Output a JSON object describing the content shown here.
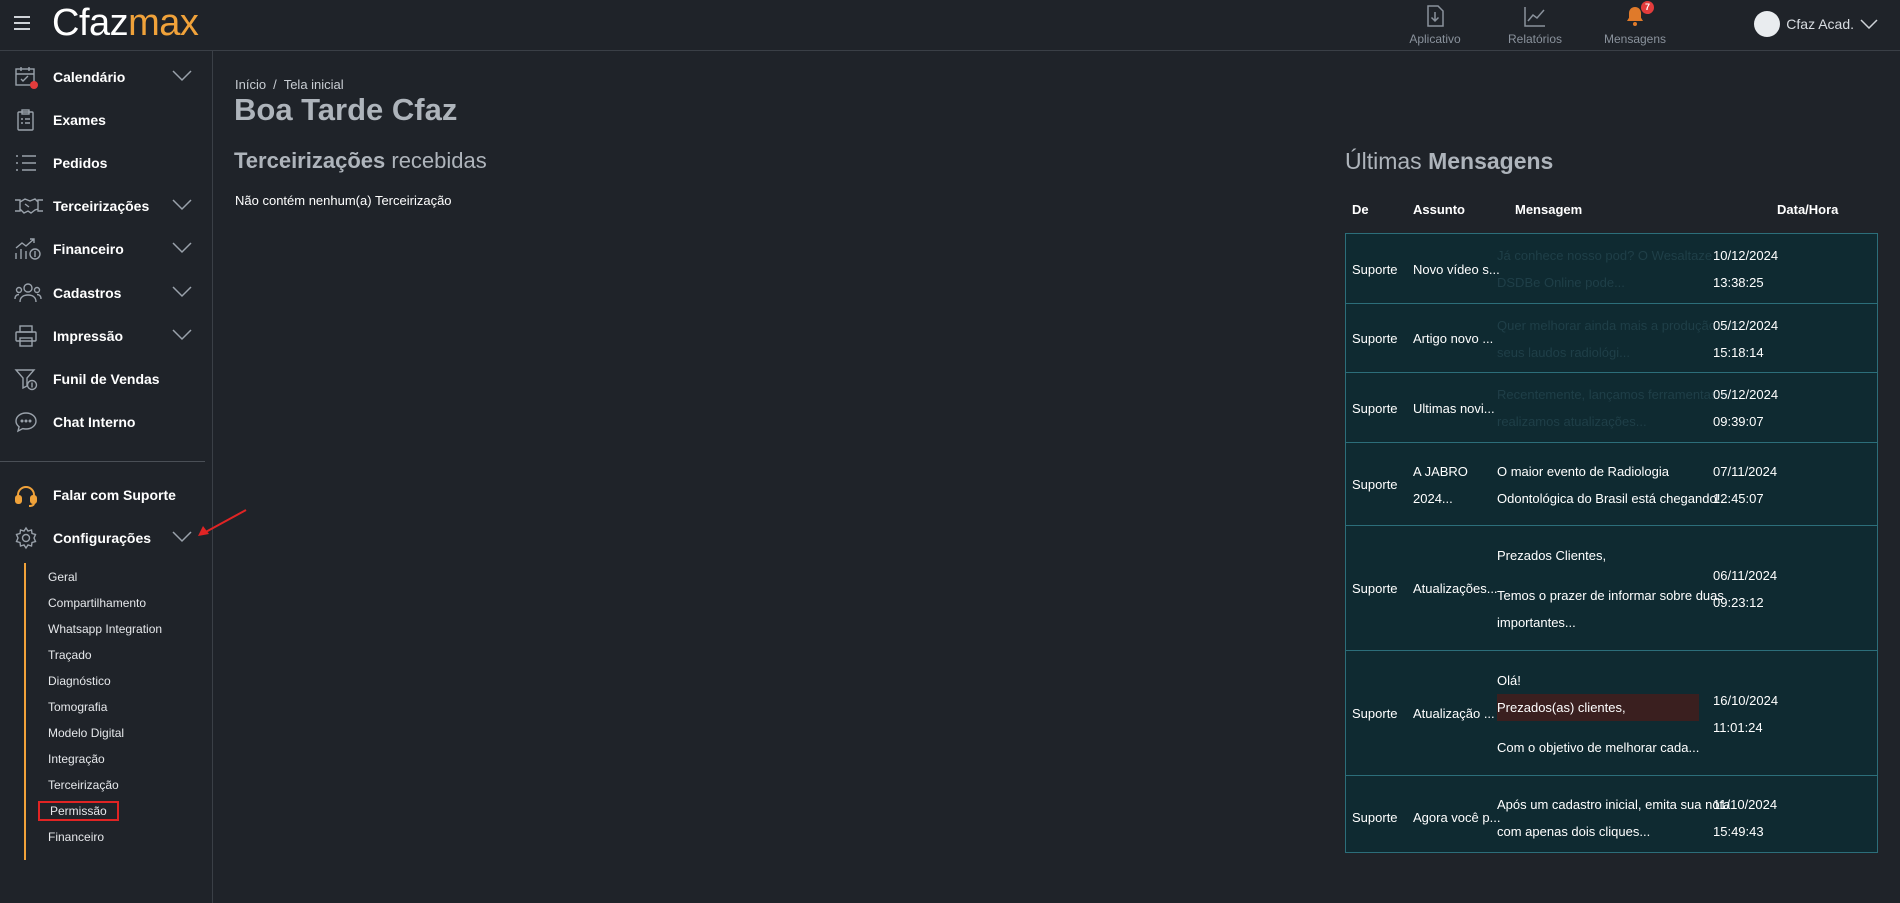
{
  "header": {
    "logo_part1": "Cfaz",
    "logo_part2": "max",
    "nav": [
      {
        "label": "Aplicativo",
        "icon": "download-icon"
      },
      {
        "label": "Relatórios",
        "icon": "chart-icon"
      },
      {
        "label": "Mensagens",
        "icon": "bell-icon",
        "badge": "7"
      }
    ],
    "user_name": "Cfaz Acad."
  },
  "sidebar": {
    "items": [
      {
        "label": "Calendário",
        "icon": "calendar-icon",
        "expandable": true
      },
      {
        "label": "Exames",
        "icon": "clipboard-icon",
        "expandable": false
      },
      {
        "label": "Pedidos",
        "icon": "list-icon",
        "expandable": false
      },
      {
        "label": "Terceirizações",
        "icon": "handshake-icon",
        "expandable": true
      },
      {
        "label": "Financeiro",
        "icon": "finance-icon",
        "expandable": true
      },
      {
        "label": "Cadastros",
        "icon": "users-icon",
        "expandable": true
      },
      {
        "label": "Impressão",
        "icon": "printer-icon",
        "expandable": true
      },
      {
        "label": "Funil de Vendas",
        "icon": "funnel-icon",
        "expandable": false
      },
      {
        "label": "Chat Interno",
        "icon": "chat-icon",
        "expandable": false
      }
    ],
    "support_label": "Falar com Suporte",
    "settings_label": "Configurações",
    "settings_sub": [
      "Geral",
      "Compartilhamento",
      "Whatsapp Integration",
      "Traçado",
      "Diagnóstico",
      "Tomografia",
      "Modelo Digital",
      "Integração",
      "Terceirização",
      "Permissão",
      "Financeiro"
    ],
    "active_sub": "Permissão"
  },
  "breadcrumb": {
    "home": "Início",
    "separator": "/",
    "current": "Tela inicial"
  },
  "greeting": "Boa Tarde Cfaz",
  "outsourcing": {
    "title_bold": "Terceirizações",
    "title_rest": " recebidas",
    "empty_text": "Não contém nenhum(a) Terceirização"
  },
  "messages": {
    "title_light": "Últimas ",
    "title_bold": "Mensagens",
    "columns": [
      "De",
      "Assunto",
      "Mensagem",
      "Data/Hora"
    ],
    "rows": [
      {
        "from": "Suporte",
        "subject": [
          "Novo vídeo s..."
        ],
        "message": [
          "Já conhece nosso pod? O Wesaltaze",
          "DSDBe Online pode..."
        ],
        "faded": true,
        "date": "10/12/2024",
        "time": "13:38:25"
      },
      {
        "from": "Suporte",
        "subject": [
          "Artigo novo ..."
        ],
        "message": [
          "Quer melhorar ainda mais a produção dos",
          "seus laudos radiológi..."
        ],
        "faded": true,
        "date": "05/12/2024",
        "time": "15:18:14"
      },
      {
        "from": "Suporte",
        "subject": [
          "Ultimas novi..."
        ],
        "message": [
          "Recentemente, lançamos ferramentas e",
          "realizamos atualizações..."
        ],
        "faded": true,
        "date": "05/12/2024",
        "time": "09:39:07"
      },
      {
        "from": "Suporte",
        "subject": [
          "A JABRO",
          "2024..."
        ],
        "message": [
          "O maior evento de Radiologia",
          "Odontológica do Brasil está chegando!..."
        ],
        "faded": false,
        "date": "07/11/2024",
        "time": "12:45:07"
      },
      {
        "from": "Suporte",
        "subject": [
          "Atualizações..."
        ],
        "message": [
          "Prezados Clientes,",
          "",
          "Temos o prazer de informar sobre duas",
          "importantes..."
        ],
        "faded": false,
        "date": "06/11/2024",
        "time": "09:23:12"
      },
      {
        "from": "Suporte",
        "subject": [
          "Atualização ..."
        ],
        "message": [
          "Olá!",
          "Prezados(as) clientes,",
          "",
          "Com o objetivo de melhorar cada..."
        ],
        "faded": false,
        "date": "16/10/2024",
        "time": "11:01:24"
      },
      {
        "from": "Suporte",
        "subject": [
          "Agora você p..."
        ],
        "message": [
          "Após um cadastro inicial, emita sua nota",
          "com apenas dois cliques..."
        ],
        "faded": false,
        "date": "11/10/2024",
        "time": "15:49:43"
      }
    ]
  },
  "colors": {
    "accent": "#f0a23a",
    "background": "#1f2329",
    "table_bg": "#0f2a31",
    "table_border": "#2c6e7a",
    "highlight": "#e02424"
  }
}
